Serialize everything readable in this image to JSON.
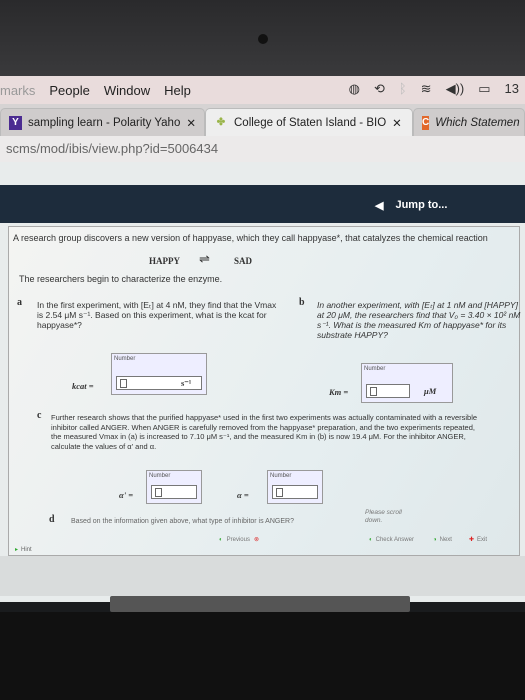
{
  "menubar": {
    "items": [
      "marks",
      "People",
      "Window",
      "Help"
    ],
    "clock": "13"
  },
  "tabs": [
    {
      "label": "sampling learn - Polarity Yaho",
      "icon": "yahoo-icon",
      "color": "#4b2c91",
      "letter": "Y"
    },
    {
      "label": "College of Staten Island - BIO",
      "icon": "csi-leaf-icon",
      "color": "#9ab54a",
      "active": true
    },
    {
      "label": "Which Statemen",
      "icon": "chegg-icon",
      "color": "#e2682b",
      "letter": "C"
    }
  ],
  "url": "scms/mod/ibis/view.php?id=5006434",
  "jump_label": "Jump to...",
  "question": {
    "intro": "A research group discovers a new version of happyase, which they call happyase*, that catalyzes the chemical reaction",
    "reactant": "HAPPY",
    "product": "SAD",
    "arrow": "⇌",
    "sub": "The researchers begin to characterize the enzyme.",
    "a": {
      "letter": "a",
      "text": "In the first experiment, with [Eₜ] at 4 nM, they find that the Vmax is 2.54 μM s⁻¹. Based on this experiment, what is the kcat for happyase*?",
      "var": "kcat =",
      "unit": "s⁻¹",
      "box_label": "Number"
    },
    "b": {
      "letter": "b",
      "text": "In another experiment, with [Eₜ] at 1 nM and [HAPPY] at 20 μM, the researchers find that V₀ = 3.40 × 10² nM s⁻¹. What is the measured Km of happyase* for its substrate HAPPY?",
      "var": "Km =",
      "unit": "μM",
      "box_label": "Number"
    },
    "c": {
      "letter": "c",
      "text": "Further research shows that the purified happyase* used in the first two experiments was actually contaminated with a reversible inhibitor called ANGER. When ANGER is carefully removed from the happyase* preparation, and the two experiments repeated, the measured Vmax in (a) is increased to 7.10 μM s⁻¹, and the measured Km in (b) is now 19.4 μM. For the inhibitor ANGER, calculate the values of α' and α.",
      "var1": "α' =",
      "var2": "α =",
      "box_label": "Number"
    },
    "d": {
      "letter": "d",
      "text": "Based on the information given above, what type of inhibitor is ANGER?"
    },
    "scroll_note": "Please scroll down."
  },
  "footer": {
    "hint": "Hint",
    "previous": "Previous",
    "check": "Check Answer",
    "next": "Next",
    "exit": "Exit"
  }
}
